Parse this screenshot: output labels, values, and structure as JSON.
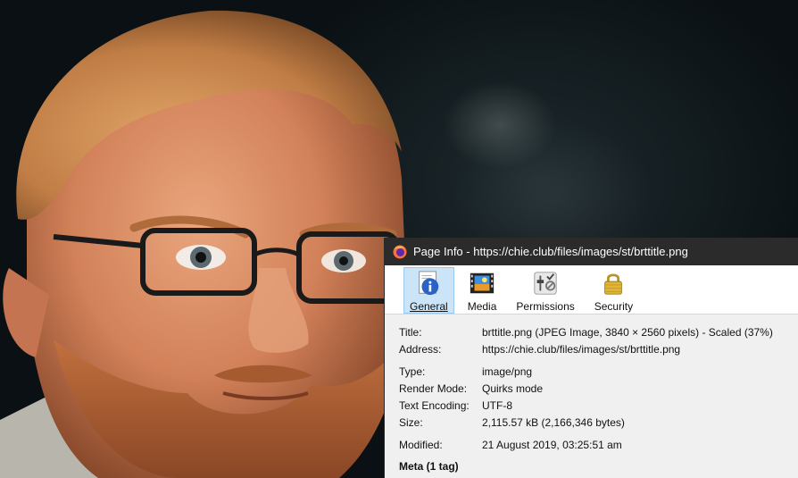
{
  "window": {
    "title": "Page Info - https://chie.club/files/images/st/brttitle.png"
  },
  "tabs": [
    {
      "label": "General",
      "icon": "info-icon",
      "active": true
    },
    {
      "label": "Media",
      "icon": "media-icon",
      "active": false
    },
    {
      "label": "Permissions",
      "icon": "permissions-icon",
      "active": false
    },
    {
      "label": "Security",
      "icon": "lock-icon",
      "active": false
    }
  ],
  "general": {
    "title_label": "Title:",
    "title_value": "brttitle.png (JPEG Image, 3840 × 2560 pixels) - Scaled (37%)",
    "address_label": "Address:",
    "address_value": "https://chie.club/files/images/st/brttitle.png",
    "type_label": "Type:",
    "type_value": "image/png",
    "render_label": "Render Mode:",
    "render_value": "Quirks mode",
    "encoding_label": "Text Encoding:",
    "encoding_value": "UTF-8",
    "size_label": "Size:",
    "size_value": "2,115.57 kB (2,166,346 bytes)",
    "modified_label": "Modified:",
    "modified_value": "21 August 2019, 03:25:51 am",
    "meta_heading": "Meta (1 tag)"
  },
  "colors": {
    "titlebar": "#2b2b2b",
    "active_tab": "#cce4f7",
    "panel": "#f0f0f0"
  }
}
